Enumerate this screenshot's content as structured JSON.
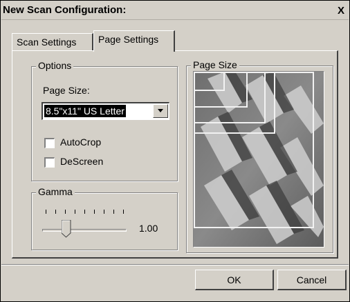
{
  "window": {
    "title": "New Scan Configuration:",
    "close_glyph": "X"
  },
  "tabs": [
    {
      "label": "Scan Settings",
      "active": false
    },
    {
      "label": "Page Settings",
      "active": true
    }
  ],
  "options": {
    "group_label": "Options",
    "page_size_label": "Page Size:",
    "page_size_value": "8.5\"x11\" US Letter",
    "autocrop_label": "AutoCrop",
    "autocrop_checked": false,
    "descreen_label": "DeScreen",
    "descreen_checked": false
  },
  "gamma": {
    "group_label": "Gamma",
    "value": "1.00"
  },
  "page_size_preview": {
    "group_label": "Page Size"
  },
  "buttons": {
    "ok": "OK",
    "cancel": "Cancel"
  }
}
